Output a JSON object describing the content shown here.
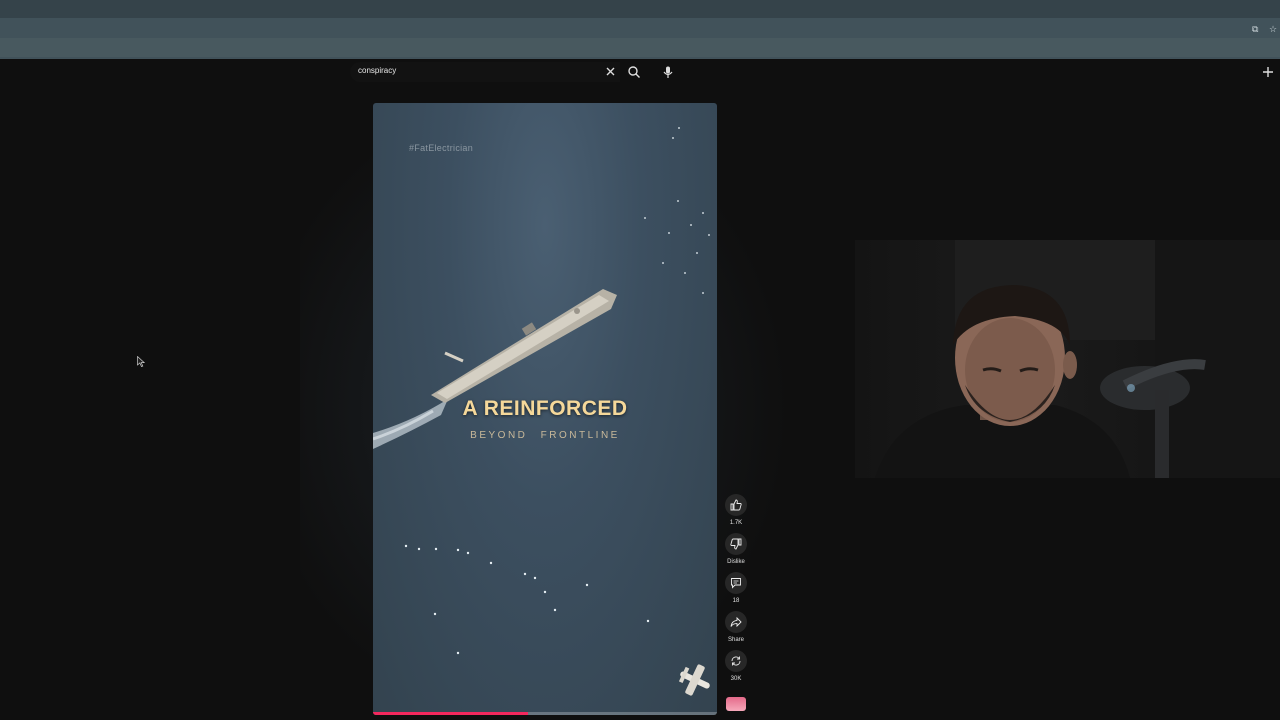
{
  "search": {
    "query": "conspiracy"
  },
  "video": {
    "watermark": "#FatElectrician",
    "caption_main": "A REINFORCED",
    "caption_sub_1": "BEYOND",
    "caption_sub_2": "FRONTLINE",
    "progress_fraction": 0.45
  },
  "actions": {
    "like_count": "1.7K",
    "dislike_label": "Dislike",
    "comment_count": "18",
    "share_label": "Share",
    "remix_count": "30K"
  },
  "colors": {
    "accent": "#f4285d",
    "caption": "#f5d89a"
  },
  "icons": [
    "clear-icon",
    "search-icon",
    "mic-icon",
    "create-icon",
    "like-icon",
    "dislike-icon",
    "comment-icon",
    "share-icon",
    "remix-icon",
    "cursor-icon"
  ]
}
